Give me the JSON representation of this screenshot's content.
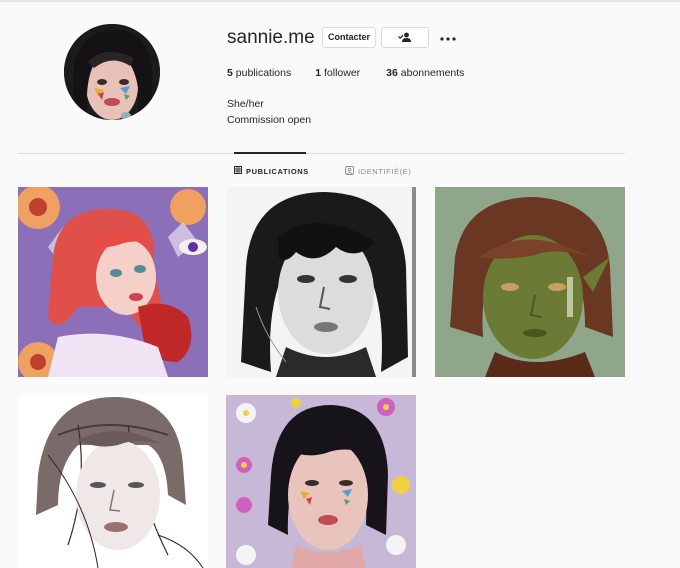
{
  "profile": {
    "username": "sannie.me",
    "contact_label": "Contacter",
    "follow_icon": "person-check-icon",
    "more_icon": "more-dots-icon"
  },
  "stats": {
    "posts_count": "5",
    "posts_label": "publications",
    "followers_count": "1",
    "followers_label": "follower",
    "following_count": "36",
    "following_label": "abonnements"
  },
  "bio": {
    "pronouns": "She/her",
    "status": "Commission open"
  },
  "tabs": [
    {
      "label": "PUBLICATIONS",
      "icon": "grid-icon",
      "active": true
    },
    {
      "label": "IDENTIFIÉ(E)",
      "icon": "tag-icon",
      "active": false
    }
  ],
  "posts": [
    {
      "description": "red-haired girl with heart painting"
    },
    {
      "description": "black and white portrait"
    },
    {
      "description": "green-skinned character portrait"
    },
    {
      "description": "sketch portrait"
    },
    {
      "description": "dark-haired girl with flowers"
    }
  ]
}
